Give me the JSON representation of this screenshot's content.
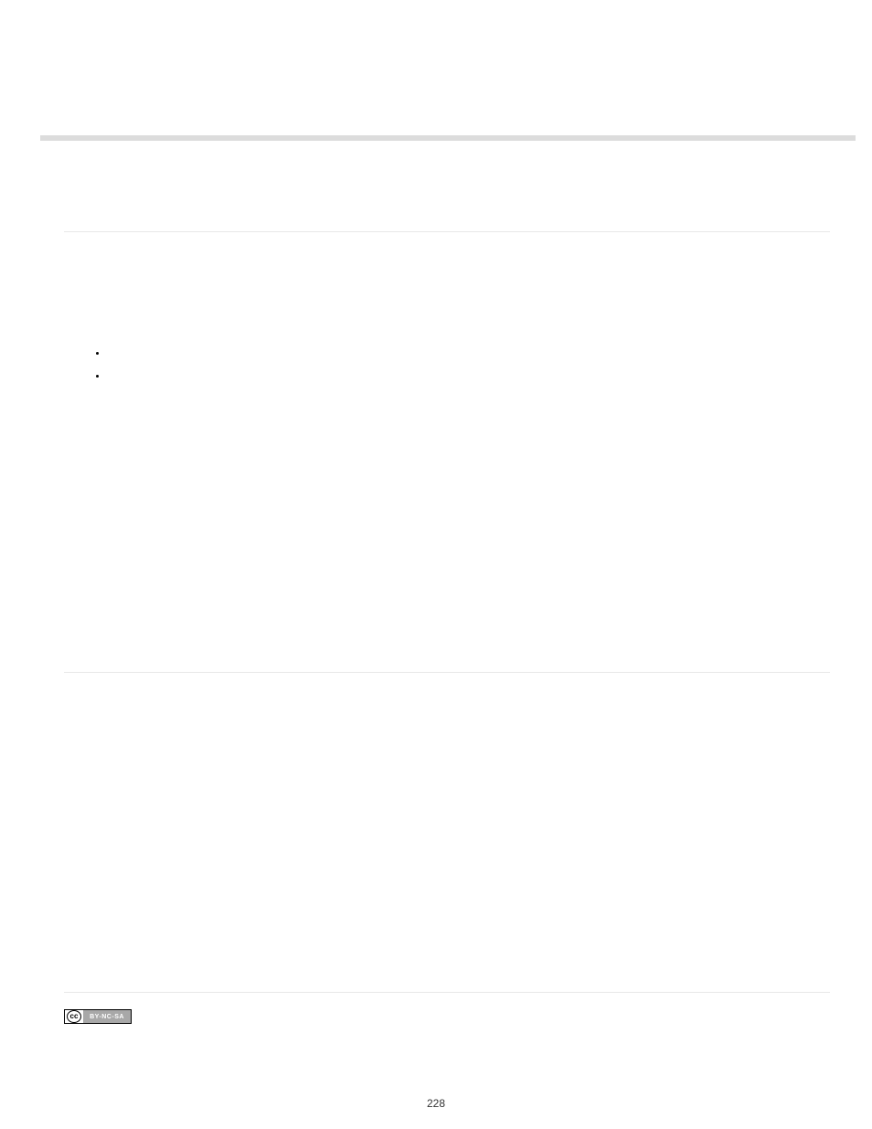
{
  "license": {
    "icon_text": "cc",
    "label": "BY-NC-SA"
  },
  "page_number": "228"
}
